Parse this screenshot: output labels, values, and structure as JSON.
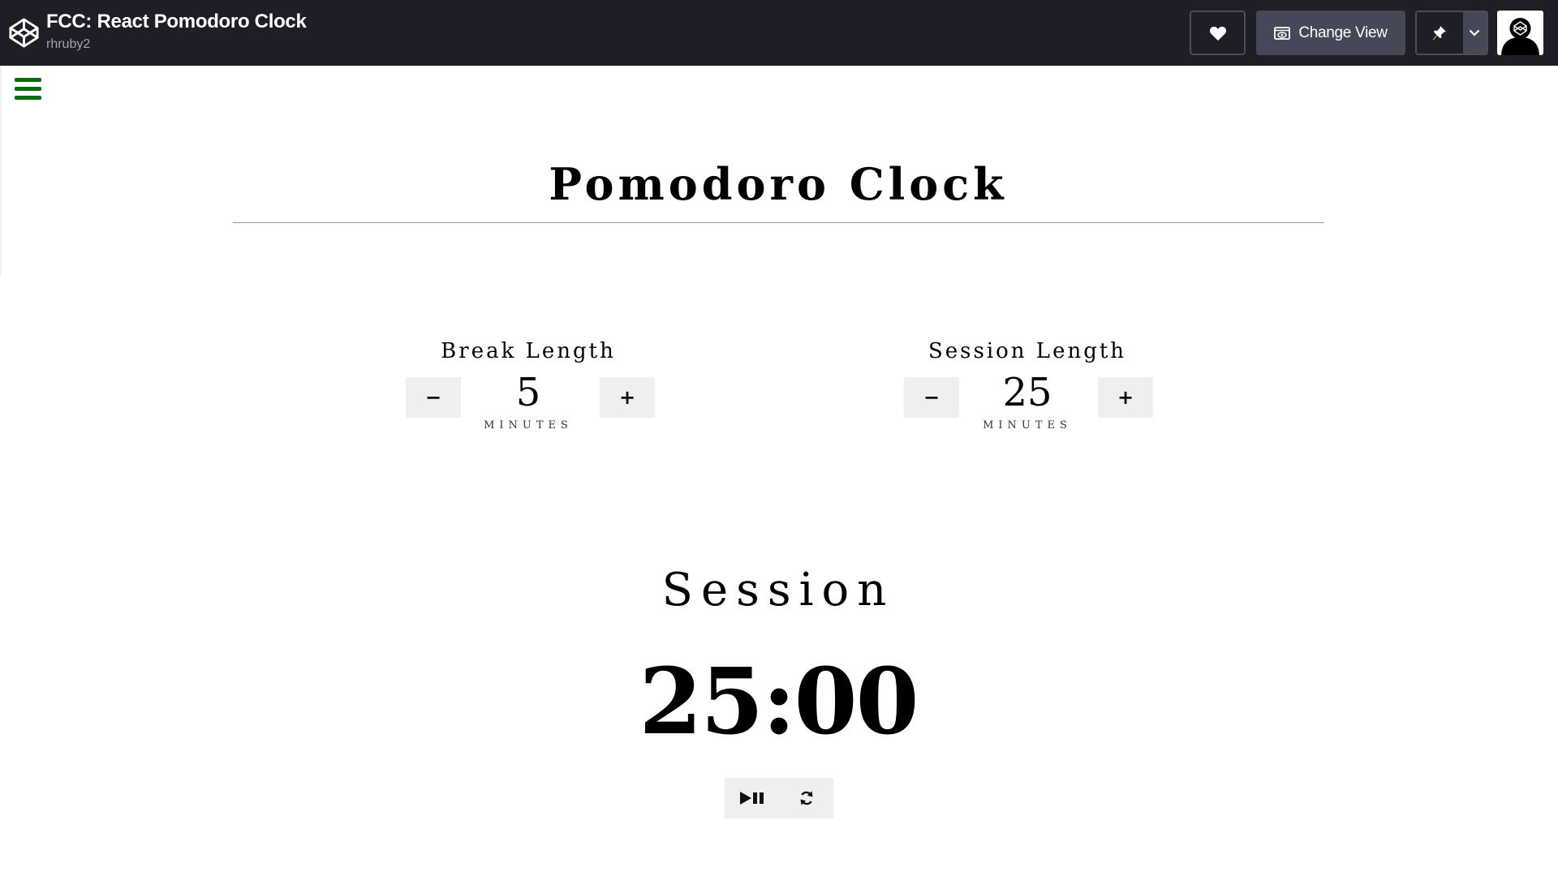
{
  "header": {
    "title": "FCC: React Pomodoro Clock",
    "author": "rhruby2",
    "change_view_label": "Change View",
    "icons": {
      "logo": "codepen-logo-icon",
      "heart": "heart-icon",
      "view": "eye-window-icon",
      "pin": "pin-icon",
      "dropdown": "chevron-down-icon",
      "avatar": "user-avatar-icon"
    }
  },
  "menu": {
    "icon": "hamburger-menu-icon",
    "color": "#0b6b10"
  },
  "app": {
    "title": "Pomodoro Clock",
    "break": {
      "label": "Break Length",
      "value": "5",
      "unit": "MINUTES",
      "decrement": "−",
      "increment": "+"
    },
    "session": {
      "label": "Session Length",
      "value": "25",
      "unit": "MINUTES",
      "decrement": "−",
      "increment": "+"
    },
    "timer": {
      "label": "Session",
      "time": "25:00"
    },
    "controls": {
      "play_pause_icon": "play-pause-icon",
      "reset_icon": "refresh-icon"
    }
  },
  "colors": {
    "topbar": "#1e1f26",
    "button_bg": "#efefef",
    "accent_menu": "#0b6b10"
  }
}
